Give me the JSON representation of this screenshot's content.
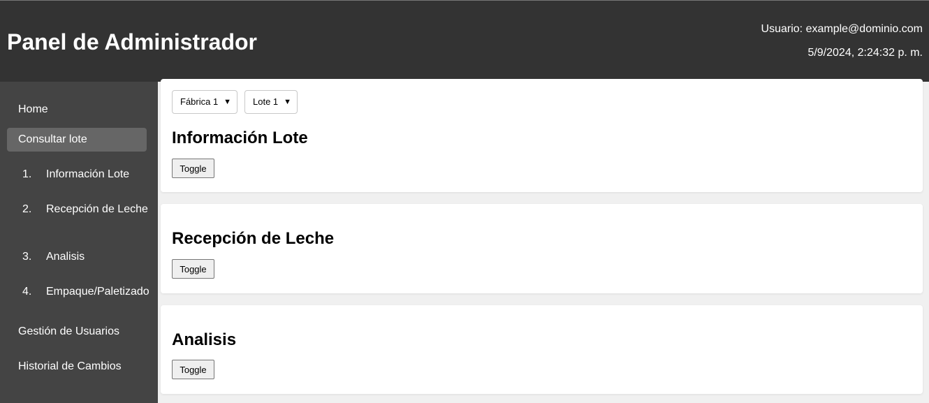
{
  "header": {
    "title": "Panel de Administrador",
    "user": "Usuario: example@dominio.com",
    "datetime": "5/9/2024, 2:24:32 p. m."
  },
  "sidebar": {
    "items": [
      {
        "label": "Home"
      },
      {
        "label": "Consultar lote",
        "active": true
      },
      {
        "label": "Gestión de Usuarios"
      },
      {
        "label": "Historial de Cambios"
      }
    ],
    "sub_items": [
      {
        "num": "1.",
        "label": "Información Lote"
      },
      {
        "num": "2.",
        "label": "Recepción de Leche"
      },
      {
        "num": "3.",
        "label": "Analisis"
      },
      {
        "num": "4.",
        "label": "Empaque/Paletizado"
      }
    ]
  },
  "filters": {
    "factory": "Fábrica 1",
    "lot": "Lote 1"
  },
  "sections": [
    {
      "title": "Información Lote",
      "button": "Toggle"
    },
    {
      "title": "Recepción de Leche",
      "button": "Toggle"
    },
    {
      "title": "Analisis",
      "button": "Toggle"
    }
  ],
  "colors": {
    "header_bg": "#333333",
    "sidebar_bg": "#444444",
    "active_item_bg": "#666666",
    "content_bg": "#f0f0f0"
  }
}
